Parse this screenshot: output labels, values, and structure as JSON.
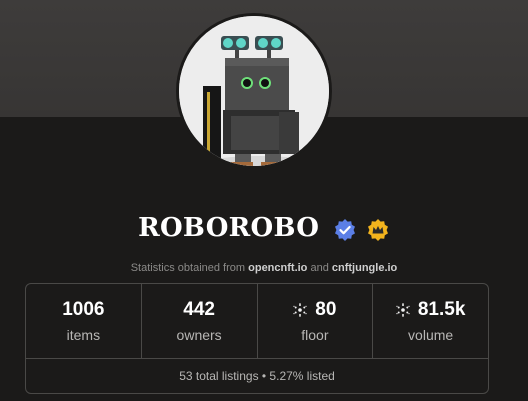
{
  "collection": {
    "name": "ROBOROBO",
    "badges": [
      "verified-badge-icon",
      "crown-badge-icon"
    ]
  },
  "stats_source": {
    "prefix": "Statistics obtained from",
    "link1": "opencnft.io",
    "join": "and",
    "link2": "cnftjungle.io"
  },
  "stats": {
    "items": {
      "value": "1006",
      "label": "items"
    },
    "owners": {
      "value": "442",
      "label": "owners"
    },
    "floor": {
      "value": "80",
      "label": "floor",
      "icon": "cardano-icon"
    },
    "volume": {
      "value": "81.5k",
      "label": "volume",
      "icon": "cardano-icon"
    }
  },
  "listings": {
    "text": "53 total listings • 5.27% listed"
  },
  "colors": {
    "background": "#1b1a19",
    "banner": "#3e3c3b",
    "verified_blue": "#5b7fe6",
    "crown_gold": "#f2b31d"
  }
}
